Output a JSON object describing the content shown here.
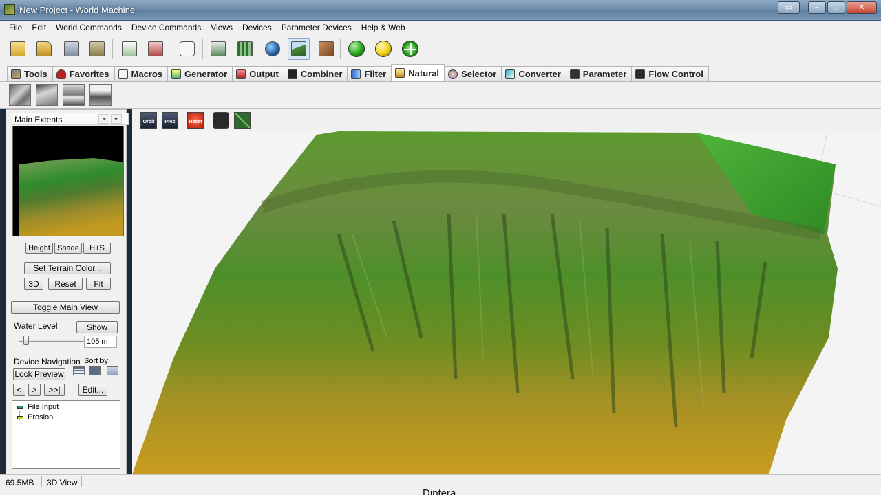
{
  "window": {
    "title": "New Project - World Machine"
  },
  "menu": [
    "File",
    "Edit",
    "World Commands",
    "Device Commands",
    "Views",
    "Devices",
    "Parameter Devices",
    "Help & Web"
  ],
  "tabs": [
    {
      "label": "Tools",
      "icon": "tools-icon"
    },
    {
      "label": "Favorites",
      "icon": "heart-icon"
    },
    {
      "label": "Macros",
      "icon": "macro-icon"
    },
    {
      "label": "Generator",
      "icon": "generator-icon"
    },
    {
      "label": "Output",
      "icon": "output-icon"
    },
    {
      "label": "Combiner",
      "icon": "combiner-icon"
    },
    {
      "label": "Filter",
      "icon": "filter-icon"
    },
    {
      "label": "Natural",
      "icon": "natural-icon"
    },
    {
      "label": "Selector",
      "icon": "selector-icon"
    },
    {
      "label": "Converter",
      "icon": "converter-icon"
    },
    {
      "label": "Parameter",
      "icon": "parameter-icon"
    },
    {
      "label": "Flow Control",
      "icon": "flow-control-icon"
    }
  ],
  "active_tab": "Natural",
  "left_panel": {
    "header": "Main Extents",
    "view_modes": [
      "Height",
      "Shade",
      "H+S"
    ],
    "set_terrain_color": "Set Terrain Color...",
    "view_buttons": [
      "3D",
      "Reset",
      "Fit"
    ],
    "toggle_main_view": "Toggle Main View",
    "water_level_label": "Water Level",
    "show_button": "Show",
    "water_level_value": "105 m",
    "water_level_fraction": 0.08,
    "device_navigation_label": "Device Navigation",
    "sort_by_label": "Sort by:",
    "lock_preview": "Lock Preview",
    "nav_buttons": [
      "<",
      ">",
      ">>|"
    ],
    "edit_button": "Edit...",
    "tree": [
      "File Input",
      "Erosion"
    ]
  },
  "viewport_toolbar": {
    "orbit": "Orbit",
    "prec": "Prec",
    "reset": "Reset"
  },
  "status": {
    "memory": "69.5MB",
    "view": "3D View"
  },
  "caption": "Diptera"
}
